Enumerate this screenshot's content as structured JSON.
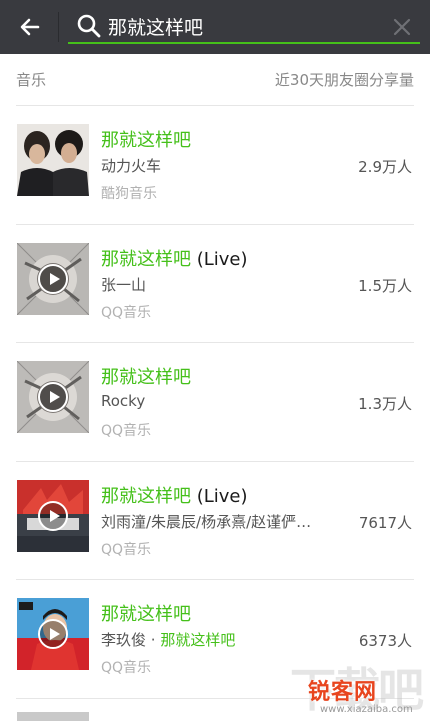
{
  "header": {
    "back_icon": "arrow-left-icon",
    "search_icon": "search-icon",
    "clear_icon": "close-icon",
    "search_value": "那就这样吧",
    "accent_color": "#45c01a",
    "bar_color": "#393a3f"
  },
  "section": {
    "title": "音乐",
    "meta": "近30天朋友圈分享量"
  },
  "results": [
    {
      "title": "那就这样吧",
      "title_suffix": "",
      "artist": "动力火车",
      "artist_highlight": "",
      "source": "酷狗音乐",
      "count": "2.9万人",
      "cover": "photo-two-men",
      "has_play": false
    },
    {
      "title": "那就这样吧",
      "title_suffix": " (Live)",
      "artist": "张一山",
      "artist_highlight": "",
      "source": "QQ音乐",
      "count": "1.5万人",
      "cover": "gray-art-album",
      "has_play": true
    },
    {
      "title": "那就这样吧",
      "title_suffix": "",
      "artist": "Rocky",
      "artist_highlight": "",
      "source": "QQ音乐",
      "count": "1.3万人",
      "cover": "gray-art-album",
      "has_play": true
    },
    {
      "title": "那就这样吧",
      "title_suffix": " (Live)",
      "artist": "刘雨潼/朱晨辰/杨承熹/赵谨俨…",
      "artist_highlight": "",
      "source": "QQ音乐",
      "count": "7617人",
      "cover": "red-show-album",
      "has_play": true
    },
    {
      "title": "那就这样吧",
      "title_suffix": "",
      "artist": "李玖俊 · ",
      "artist_highlight": "那就这样吧",
      "source": "QQ音乐",
      "count": "6373人",
      "cover": "red-portrait-album",
      "has_play": true
    }
  ],
  "watermark": {
    "ghost_text": "下载吧",
    "brand": "锐客网",
    "url": "www.xiazaiba.com"
  }
}
